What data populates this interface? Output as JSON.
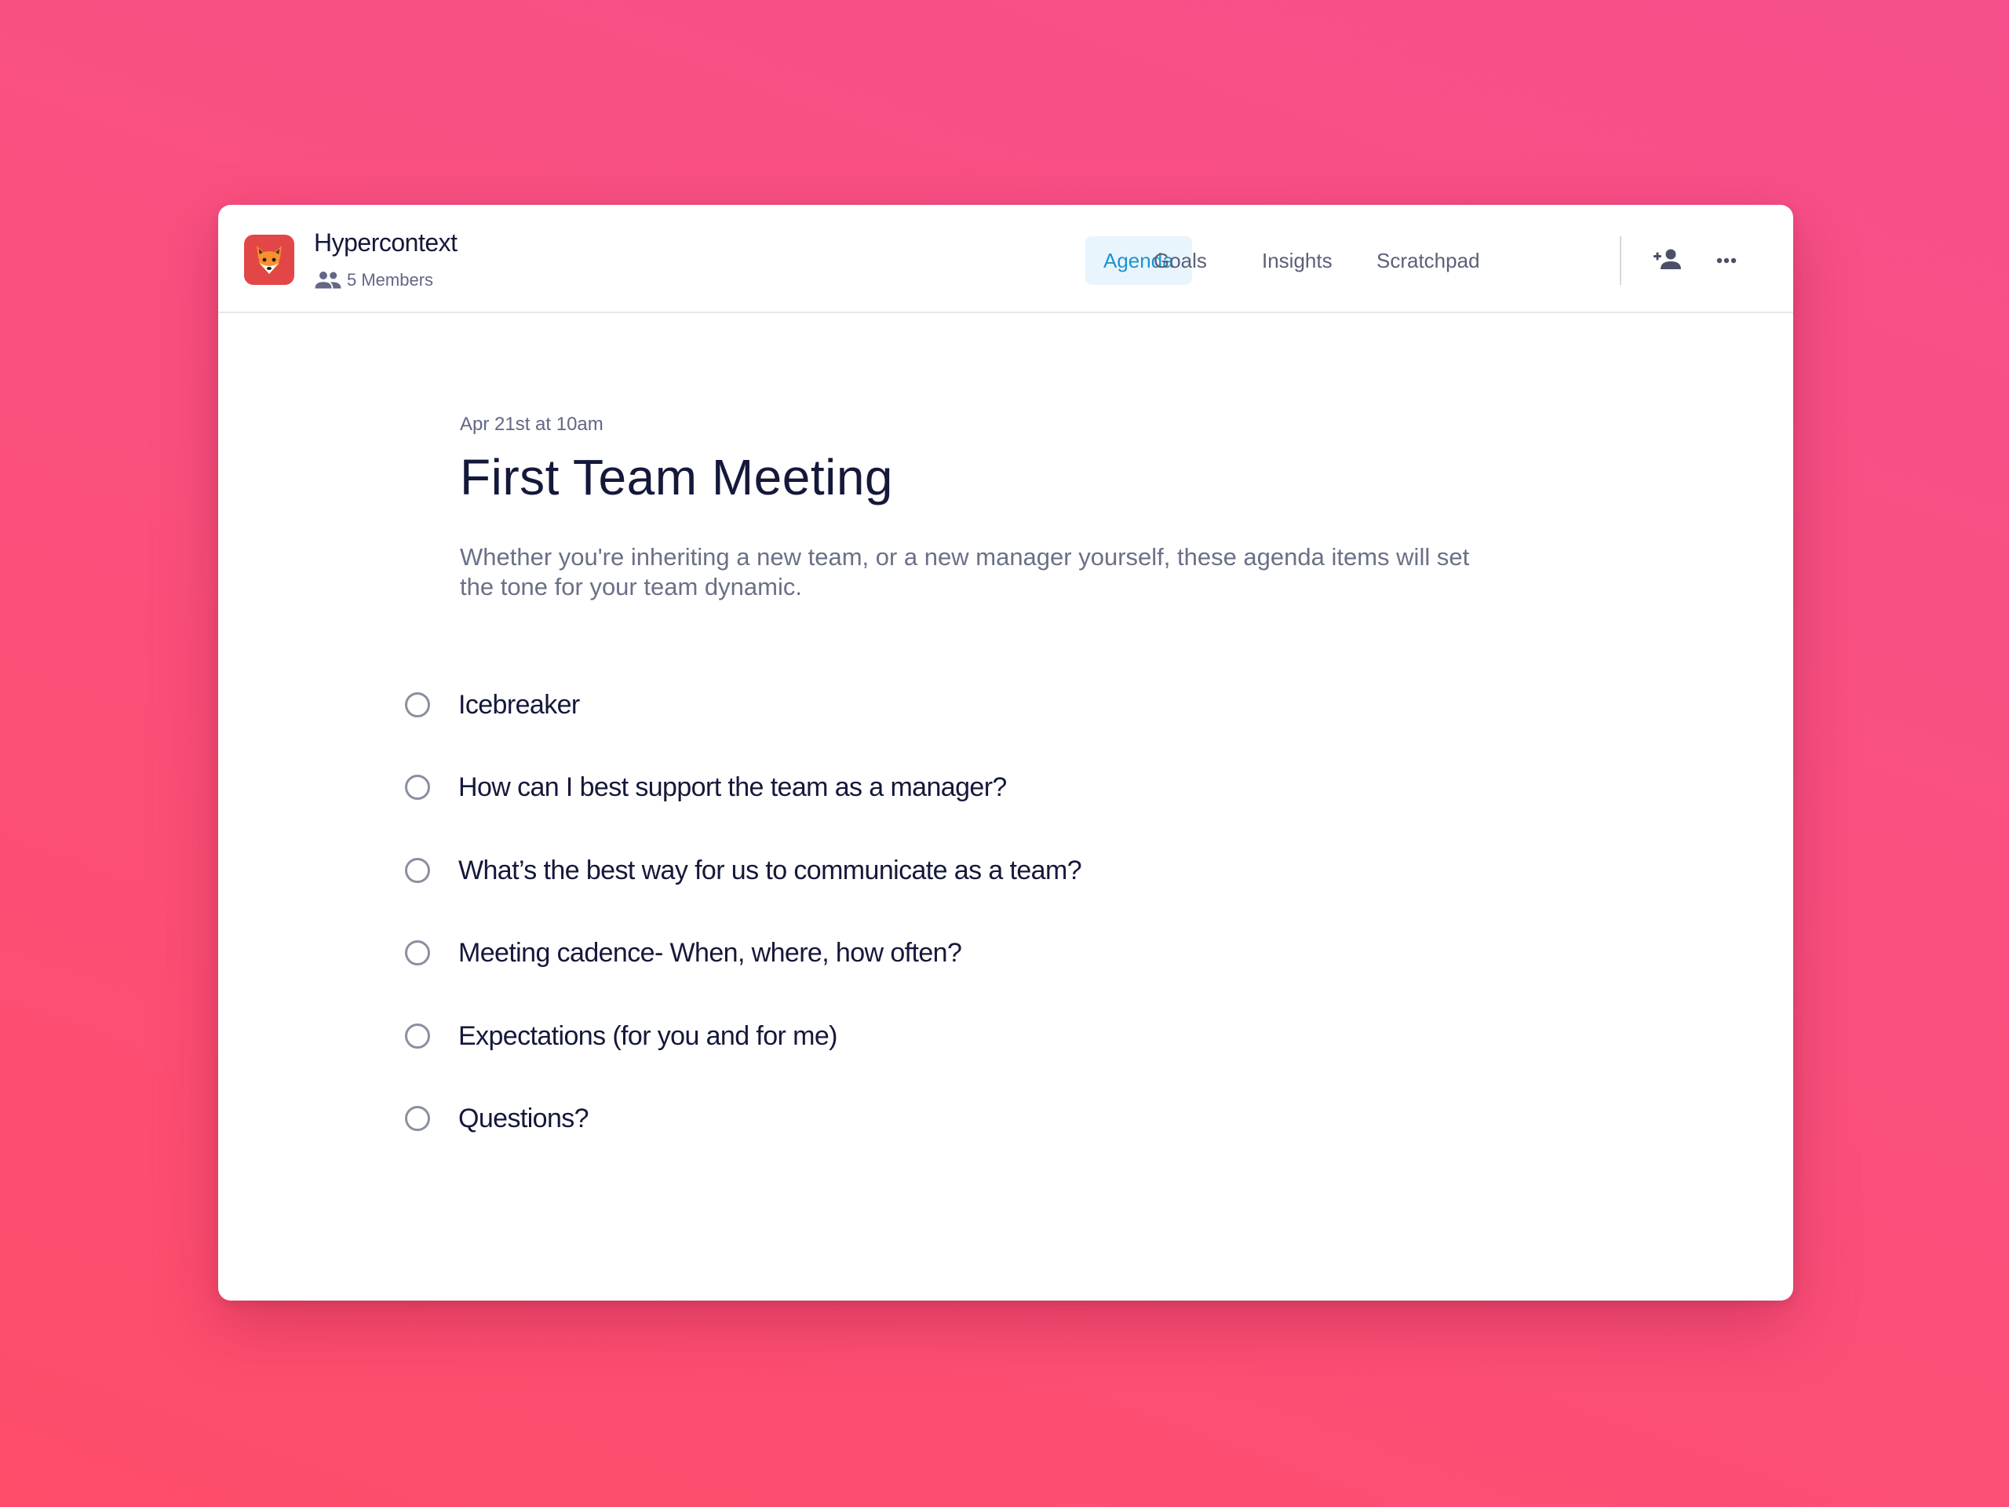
{
  "team": {
    "name": "Hypercontext",
    "members_label": "5 Members",
    "icon": "fox-icon"
  },
  "nav": {
    "tabs": [
      {
        "label": "Agenda",
        "active": true
      },
      {
        "label": "Goals",
        "active": false
      },
      {
        "label": "Insights",
        "active": false
      },
      {
        "label": "Scratchpad",
        "active": false
      }
    ],
    "actions": [
      "add-member-icon",
      "more-options-icon"
    ]
  },
  "meeting": {
    "date": "Apr 21st at 10am",
    "title": "First Team Meeting",
    "description": "Whether you're inheriting a new team, or a new manager yourself, these agenda items will set the tone for your team dynamic."
  },
  "agenda": {
    "items": [
      {
        "label": "Icebreaker",
        "checked": false
      },
      {
        "label": "How can I best support the team as a manager?",
        "checked": false
      },
      {
        "label": "What’s the best way for us to communicate as a team?",
        "checked": false
      },
      {
        "label": "Meeting cadence- When, where, how often?",
        "checked": false
      },
      {
        "label": "Expectations (for you and for me)",
        "checked": false
      },
      {
        "label": "Questions?",
        "checked": false
      }
    ]
  },
  "colors": {
    "accent": "#1e93d2",
    "accent_bg": "#e9f5fc",
    "app_icon_bg": "#e34646",
    "background_top": "#f74f8b",
    "background_bottom": "#ff4d6a"
  }
}
